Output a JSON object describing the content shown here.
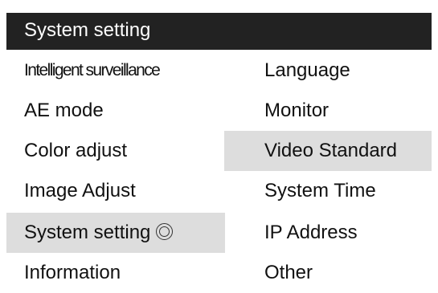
{
  "header": {
    "title": "System setting"
  },
  "left_menu": [
    {
      "label": "Intelligent surveillance",
      "selected": false
    },
    {
      "label": "AE mode",
      "selected": false
    },
    {
      "label": "Color adjust",
      "selected": false
    },
    {
      "label": "Image Adjust",
      "selected": false
    },
    {
      "label": "System setting",
      "selected": true,
      "icon": "circle-marker-icon"
    },
    {
      "label": "Information",
      "selected": false
    }
  ],
  "right_menu": [
    {
      "label": "Language",
      "selected": false
    },
    {
      "label": "Monitor",
      "selected": false
    },
    {
      "label": "Video Standard",
      "selected": true
    },
    {
      "label": "System Time",
      "selected": false
    },
    {
      "label": "IP Address",
      "selected": false
    },
    {
      "label": "Other",
      "selected": false
    }
  ],
  "colors": {
    "title_bar": "#222222",
    "title_text": "#ffffff",
    "highlight": "#dddddd",
    "text": "#111111"
  }
}
